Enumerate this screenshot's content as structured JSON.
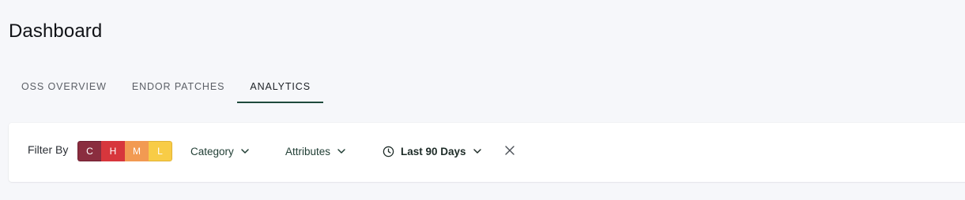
{
  "page": {
    "title": "Dashboard"
  },
  "tabs": [
    {
      "label": "OSS OVERVIEW",
      "active": false
    },
    {
      "label": "ENDOR PATCHES",
      "active": false
    },
    {
      "label": "ANALYTICS",
      "active": true
    }
  ],
  "filters": {
    "label": "Filter By",
    "severity": [
      {
        "label": "C",
        "color": "#8a2d3f"
      },
      {
        "label": "H",
        "color": "#d7363c"
      },
      {
        "label": "M",
        "color": "#f29a52"
      },
      {
        "label": "L",
        "color": "#f8cc46"
      }
    ],
    "category_label": "Category",
    "attributes_label": "Attributes",
    "date_range_label": "Last 90 Days",
    "icons": {
      "chevron": "chevron-down-icon",
      "clock": "clock-icon",
      "clear": "close-icon"
    }
  },
  "colors": {
    "accent": "#1f4a3c",
    "background": "#f6f7fa"
  }
}
